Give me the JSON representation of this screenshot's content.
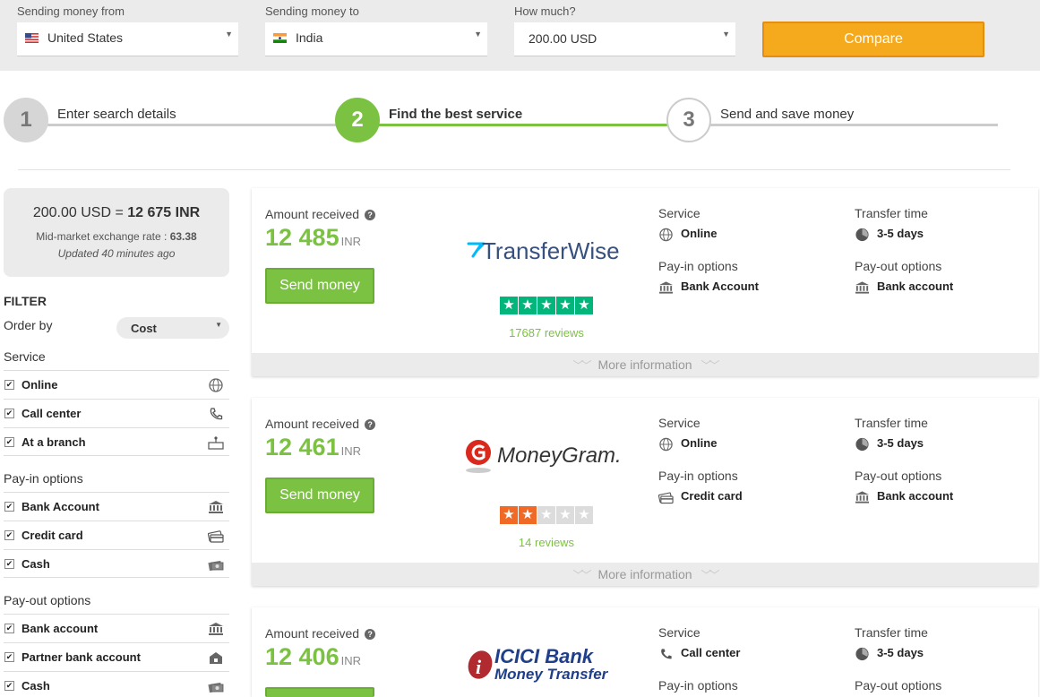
{
  "search": {
    "from_label": "Sending money from",
    "from_value": "United States",
    "to_label": "Sending money to",
    "to_value": "India",
    "amount_label": "How much?",
    "amount_value": "200.00 USD",
    "compare_label": "Compare"
  },
  "steps": [
    {
      "number": "1",
      "label": "Enter search details"
    },
    {
      "number": "2",
      "label": "Find the best service"
    },
    {
      "number": "3",
      "label": "Send and save money"
    }
  ],
  "rate": {
    "base": "200.00 USD =",
    "converted": "12 675 INR",
    "mid_label": "Mid-market exchange rate :",
    "mid_value": "63.38",
    "updated": "Updated 40 minutes ago"
  },
  "filter": {
    "title": "FILTER",
    "order_by_label": "Order by",
    "order_by_value": "Cost",
    "groups": [
      {
        "title": "Service",
        "items": [
          {
            "label": "Online",
            "icon": "globe-icon",
            "checked": true
          },
          {
            "label": "Call center",
            "icon": "phone-icon",
            "checked": true
          },
          {
            "label": "At a branch",
            "icon": "branch-icon",
            "checked": true
          }
        ]
      },
      {
        "title": "Pay-in options",
        "items": [
          {
            "label": "Bank Account",
            "icon": "bank-icon",
            "checked": true
          },
          {
            "label": "Credit card",
            "icon": "credit-card-icon",
            "checked": true
          },
          {
            "label": "Cash",
            "icon": "cash-icon",
            "checked": true
          }
        ]
      },
      {
        "title": "Pay-out options",
        "items": [
          {
            "label": "Bank account",
            "icon": "bank-icon",
            "checked": true
          },
          {
            "label": "Partner bank account",
            "icon": "partner-bank-icon",
            "checked": true
          },
          {
            "label": "Cash",
            "icon": "cash-icon",
            "checked": true
          }
        ]
      }
    ]
  },
  "labels": {
    "amount_received": "Amount received",
    "send_money": "Send money",
    "service": "Service",
    "transfer_time": "Transfer time",
    "pay_in": "Pay-in options",
    "pay_out": "Pay-out options",
    "more_info": "More information"
  },
  "providers": [
    {
      "name": "TransferWise",
      "amount": "12 485",
      "currency": "INR",
      "rating_stars": 5,
      "reviews": "17687 reviews",
      "service": "Online",
      "transfer_time": "3-5 days",
      "pay_in": "Bank Account",
      "pay_out": "Bank account"
    },
    {
      "name": "MoneyGram.",
      "amount": "12 461",
      "currency": "INR",
      "rating_stars": 2,
      "reviews": "14 reviews",
      "service": "Online",
      "transfer_time": "3-5 days",
      "pay_in": "Credit card",
      "pay_out": "Bank account"
    },
    {
      "name_line1": "ICICI Bank",
      "name_line2": "Money Transfer",
      "amount": "12 406",
      "currency": "INR",
      "service": "Call center",
      "transfer_time": "3-5 days",
      "pay_in_label_only": true,
      "pay_out_label_only": true
    }
  ],
  "colors": {
    "accent_green": "#7cc242",
    "compare_orange": "#f5a91c",
    "star_green": "#00b67a",
    "star_orange": "#f06a26"
  }
}
